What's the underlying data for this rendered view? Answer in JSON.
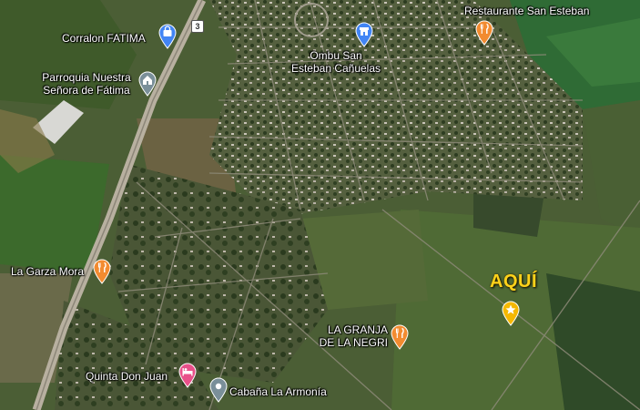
{
  "map": {
    "route_shield": "3",
    "places": [
      {
        "id": "corralon",
        "name": "Corralon FATIMA",
        "icon": "shopping-bag-icon",
        "color": "#4285f4"
      },
      {
        "id": "parroquia",
        "name_lines": [
          "Parroquia Nuestra",
          "Señora de Fátima"
        ],
        "icon": "church-icon",
        "color": "#7a8f99"
      },
      {
        "id": "ombu",
        "name_lines": [
          "Ombu San",
          "Esteban Cañuelas"
        ],
        "icon": "store-icon",
        "color": "#4285f4"
      },
      {
        "id": "restaurante",
        "name": "Restaurante San Esteban",
        "icon": "restaurant-icon",
        "color": "#f28b30"
      },
      {
        "id": "garza",
        "name": "La Garza Mora",
        "icon": "restaurant-icon",
        "color": "#f28b30"
      },
      {
        "id": "granja",
        "name_lines": [
          "LA GRANJA",
          "DE LA NEGRI"
        ],
        "icon": "restaurant-icon",
        "color": "#f28b30"
      },
      {
        "id": "quinta",
        "name": "Quinta Don Juan",
        "icon": "hotel-bed-icon",
        "color": "#e8508a"
      },
      {
        "id": "cabana",
        "name": "Cabaña La Armonía",
        "icon": "place-pin-icon",
        "color": "#7a8f99"
      }
    ],
    "marker": {
      "label": "AQUÍ",
      "icon": "star-icon",
      "color": "#f5b800"
    }
  }
}
